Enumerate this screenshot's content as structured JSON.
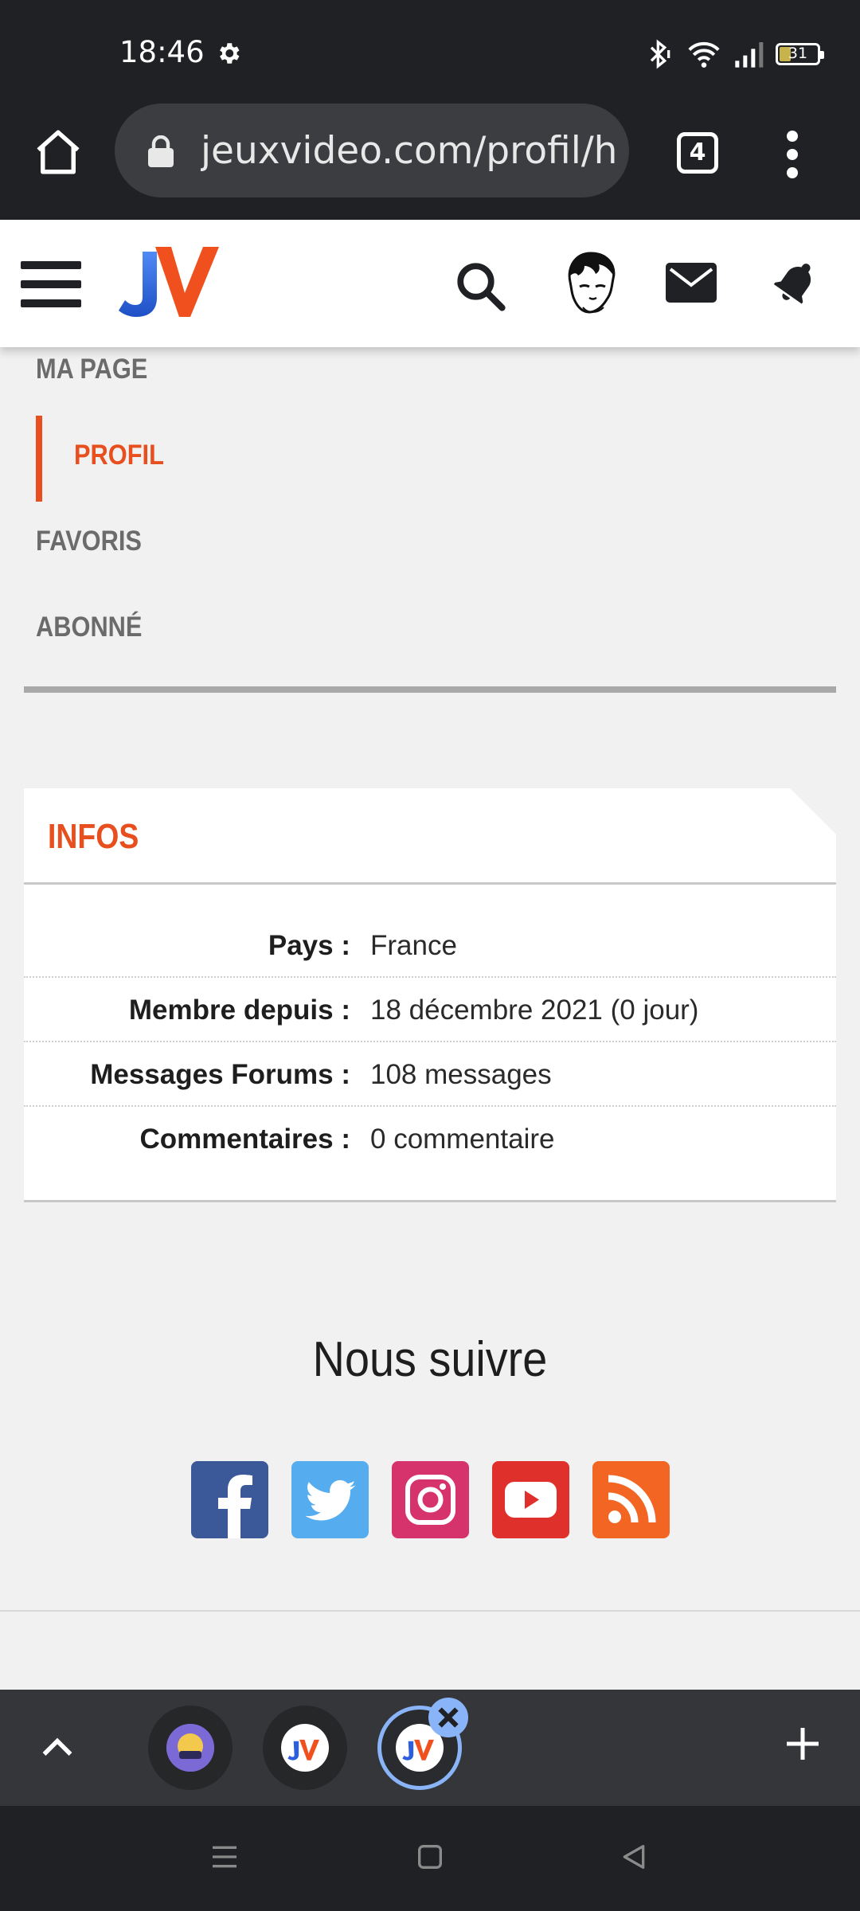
{
  "status_bar": {
    "time": "18:46",
    "battery": "31",
    "battery_level": 0.31,
    "icons": [
      "gear-icon",
      "bluetooth-icon",
      "wifi-icon",
      "signal-icon",
      "battery-icon"
    ]
  },
  "browser": {
    "url": "jeuxvideo.com/profil/haa",
    "tab_count": "4",
    "icons": [
      "home-icon",
      "lock-icon",
      "tab-switcher-icon",
      "more-vert-icon"
    ]
  },
  "header": {
    "logo": "JV",
    "icons": [
      "hamburger-icon",
      "search-icon",
      "avatar",
      "mail-icon",
      "bell-icon"
    ]
  },
  "profile_nav": {
    "items": [
      {
        "label": "MA PAGE"
      },
      {
        "label": "PROFIL",
        "active": true
      },
      {
        "label": "FAVORIS"
      },
      {
        "label": "ABONNÉ"
      }
    ]
  },
  "infos": {
    "title": "INFOS",
    "rows": [
      {
        "label": "Pays :",
        "value": "France"
      },
      {
        "label": "Membre depuis :",
        "value": "18 décembre 2021 (0 jour)"
      },
      {
        "label": "Messages Forums :",
        "value": "108 messages"
      },
      {
        "label": "Commentaires :",
        "value": "0 commentaire"
      }
    ]
  },
  "follow": {
    "title": "Nous suivre",
    "networks": [
      {
        "name": "facebook-icon",
        "color": "#3b5998"
      },
      {
        "name": "twitter-icon",
        "color": "#55acee"
      },
      {
        "name": "instagram-icon",
        "color": "#d6336c"
      },
      {
        "name": "youtube-icon",
        "color": "#e0302c"
      },
      {
        "name": "rss-icon",
        "color": "#f26522"
      }
    ]
  },
  "colors": {
    "accent": "#e7501e",
    "chrome_dark": "#202124",
    "tab_active_ring": "#8ab4f8"
  }
}
